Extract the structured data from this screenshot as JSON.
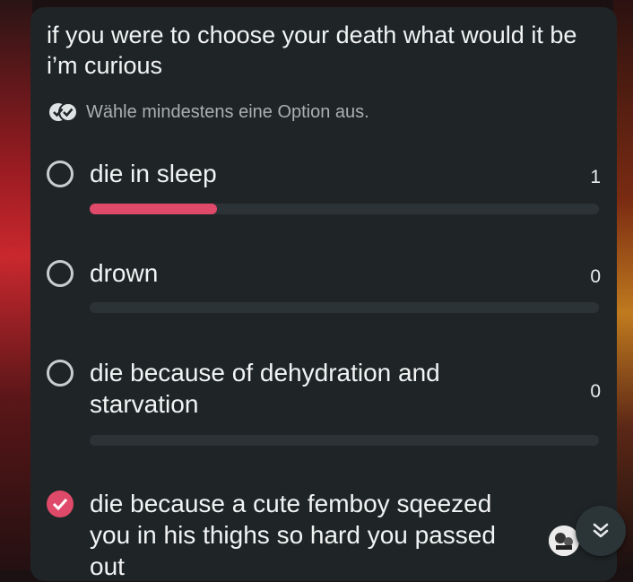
{
  "poll": {
    "question": "if you were to choose your death what would it be i’m curious",
    "instruction": "Wähle mindestens eine Option aus.",
    "accent_color": "#e04a6a",
    "options": [
      {
        "label": "die in sleep",
        "count": "1",
        "checked": false,
        "fill_fraction": 0.25
      },
      {
        "label": "drown",
        "count": "0",
        "checked": false,
        "fill_fraction": 0
      },
      {
        "label": "die because of dehydration and starvation",
        "count": "0",
        "checked": false,
        "fill_fraction": 0
      },
      {
        "label": "die because a cute femboy sqeezed you in his thighs so hard you passed out",
        "checked": true
      }
    ]
  },
  "icons": {
    "instruction": "double-check-icon",
    "scroll": "chevron-double-down-icon",
    "voter": "avatar"
  }
}
